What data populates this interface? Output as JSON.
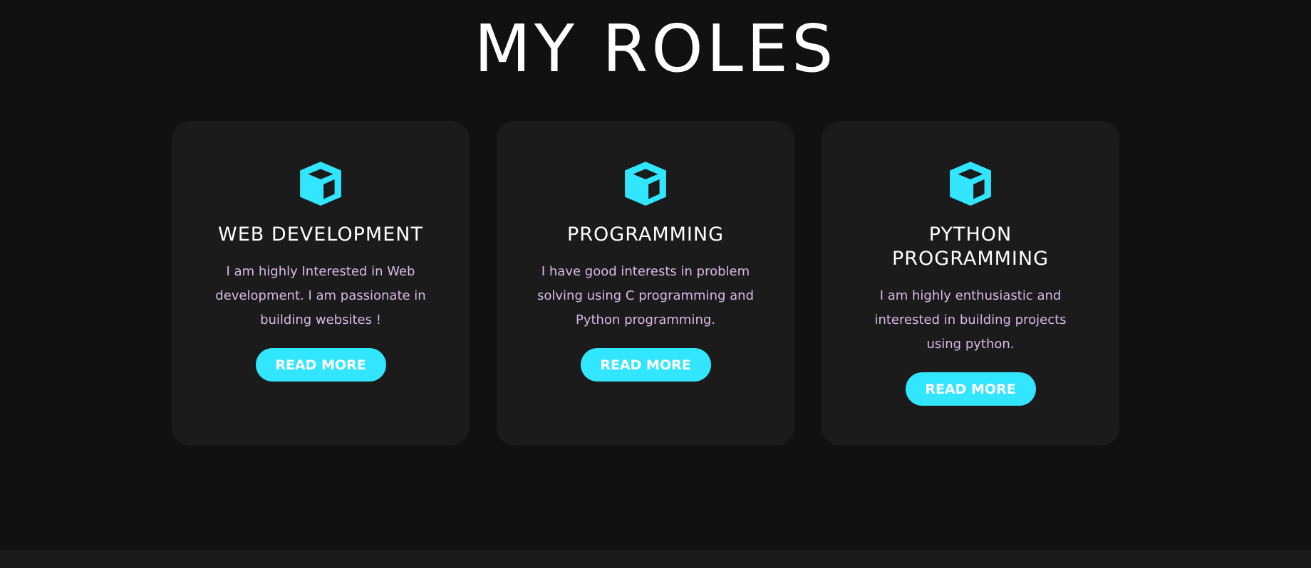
{
  "section": {
    "title": "MY ROLES"
  },
  "colors": {
    "background": "#111111",
    "card": "#1b1b1b",
    "accent": "#33e6ff",
    "description_text": "#d9b8e8"
  },
  "cards": [
    {
      "icon": "cube-icon",
      "title": "WEB DEVELOPMENT",
      "description": "I am highly Interested in Web development. I am passionate in building websites !",
      "button_label": "READ MORE"
    },
    {
      "icon": "cube-icon",
      "title": "PROGRAMMING",
      "description": "I have good interests in problem solving using C programming and Python programming.",
      "button_label": "READ MORE"
    },
    {
      "icon": "cube-icon",
      "title": "PYTHON PROGRAMMING",
      "description": "I am highly enthusiastic and interested in building projects using python.",
      "button_label": "READ MORE"
    }
  ]
}
